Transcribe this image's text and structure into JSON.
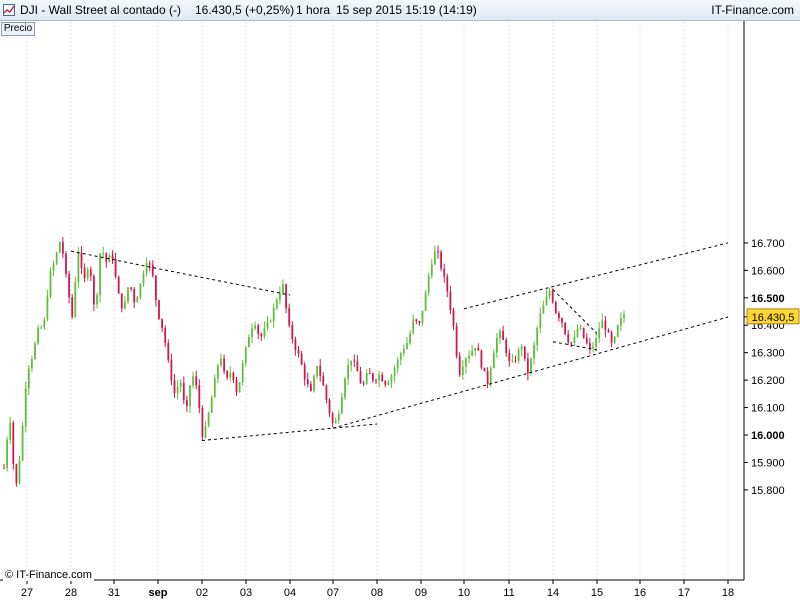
{
  "header": {
    "symbol": "DJI - Wall Street al contado (-)",
    "price_change": "16.430,5 (+0,25%)",
    "interval": "1 hora",
    "datetime": "15 sep 2015 15:19 (14:19)",
    "brand": "IT-Finance.com"
  },
  "panel_label": "Precio",
  "footer": {
    "copyright": "© IT-Finance.com"
  },
  "colors": {
    "up": "#5fbf3a",
    "down": "#d0184e",
    "last_price_bg": "#ffd633",
    "grid": "#c9c9c9"
  },
  "chart_data": {
    "type": "candlestick",
    "title": "DJI - Wall Street al contado (-)",
    "interval": "1 hora",
    "last_price": 16430.5,
    "last_price_label": "16.430,5",
    "ylim": [
      15740,
      16750
    ],
    "y_ticks": [
      15800,
      15900,
      16000,
      16100,
      16200,
      16300,
      16400,
      16500,
      16600,
      16700
    ],
    "y_tick_labels": [
      "15.800",
      "15.900",
      "16.000",
      "16.100",
      "16.200",
      "16.300",
      "16.400",
      "16.500",
      "16.600",
      "16.700"
    ],
    "y_bold_ticks": [
      16000,
      16500
    ],
    "x_tick_labels": [
      "27",
      "28",
      "31",
      "sep",
      "02",
      "03",
      "04",
      "07",
      "08",
      "09",
      "10",
      "11",
      "14",
      "15",
      "16",
      "17",
      "18"
    ],
    "grid": "vertical-dotted",
    "ohlc_path": [
      [
        0,
        15880
      ],
      [
        1,
        16080
      ],
      [
        2,
        15790
      ],
      [
        3,
        15960
      ],
      [
        4,
        16230
      ],
      [
        5,
        16290
      ],
      [
        6,
        16380
      ],
      [
        7,
        16400
      ],
      [
        8,
        16580
      ],
      [
        9,
        16640
      ],
      [
        10,
        16720
      ],
      [
        11,
        16560
      ],
      [
        12,
        16430
      ],
      [
        13,
        16680
      ],
      [
        14,
        16550
      ],
      [
        15,
        16640
      ],
      [
        16,
        16430
      ],
      [
        17,
        16690
      ],
      [
        18,
        16630
      ],
      [
        19,
        16660
      ],
      [
        20,
        16520
      ],
      [
        21,
        16450
      ],
      [
        22,
        16560
      ],
      [
        23,
        16480
      ],
      [
        24,
        16550
      ],
      [
        25,
        16640
      ],
      [
        26,
        16600
      ],
      [
        27,
        16450
      ],
      [
        28,
        16380
      ],
      [
        29,
        16250
      ],
      [
        30,
        16150
      ],
      [
        31,
        16200
      ],
      [
        32,
        16070
      ],
      [
        33,
        16230
      ],
      [
        34,
        16160
      ],
      [
        35,
        15980
      ],
      [
        36,
        16080
      ],
      [
        37,
        16190
      ],
      [
        38,
        16300
      ],
      [
        39,
        16190
      ],
      [
        40,
        16240
      ],
      [
        41,
        16150
      ],
      [
        42,
        16260
      ],
      [
        43,
        16360
      ],
      [
        44,
        16420
      ],
      [
        45,
        16350
      ],
      [
        46,
        16390
      ],
      [
        47,
        16430
      ],
      [
        48,
        16500
      ],
      [
        49,
        16550
      ],
      [
        50,
        16400
      ],
      [
        51,
        16330
      ],
      [
        52,
        16280
      ],
      [
        53,
        16200
      ],
      [
        54,
        16150
      ],
      [
        55,
        16260
      ],
      [
        56,
        16190
      ],
      [
        57,
        16100
      ],
      [
        58,
        16025
      ],
      [
        59,
        16100
      ],
      [
        60,
        16220
      ],
      [
        61,
        16280
      ],
      [
        62,
        16240
      ],
      [
        63,
        16170
      ],
      [
        64,
        16230
      ],
      [
        65,
        16200
      ],
      [
        66,
        16220
      ],
      [
        67,
        16190
      ],
      [
        68,
        16210
      ],
      [
        69,
        16260
      ],
      [
        70,
        16310
      ],
      [
        71,
        16340
      ],
      [
        72,
        16420
      ],
      [
        73,
        16400
      ],
      [
        74,
        16500
      ],
      [
        75,
        16620
      ],
      [
        76,
        16680
      ],
      [
        77,
        16600
      ],
      [
        78,
        16520
      ],
      [
        79,
        16400
      ],
      [
        80,
        16220
      ],
      [
        81,
        16280
      ],
      [
        82,
        16300
      ],
      [
        83,
        16330
      ],
      [
        84,
        16250
      ],
      [
        85,
        16190
      ],
      [
        86,
        16300
      ],
      [
        87,
        16380
      ],
      [
        88,
        16330
      ],
      [
        89,
        16250
      ],
      [
        90,
        16280
      ],
      [
        91,
        16330
      ],
      [
        92,
        16220
      ],
      [
        93,
        16300
      ],
      [
        94,
        16420
      ],
      [
        95,
        16480
      ],
      [
        96,
        16530
      ],
      [
        97,
        16450
      ],
      [
        98,
        16420
      ],
      [
        99,
        16350
      ],
      [
        100,
        16330
      ],
      [
        101,
        16400
      ],
      [
        102,
        16350
      ],
      [
        103,
        16310
      ],
      [
        104,
        16340
      ],
      [
        105,
        16420
      ],
      [
        106,
        16380
      ],
      [
        107,
        16320
      ],
      [
        108,
        16400
      ],
      [
        109,
        16440
      ]
    ],
    "trendlines": [
      {
        "x1": "28",
        "y1": 16670,
        "x2": "04",
        "y2": 16510
      },
      {
        "x1": "02",
        "y1": 15980,
        "x2": "08",
        "y2": 16040
      },
      {
        "x1": "07",
        "y1": 16025,
        "x2": "18",
        "y2": 16430
      },
      {
        "x1": "10",
        "y1": 16460,
        "x2": "18",
        "y2": 16700
      },
      {
        "x1": "14",
        "y1": 16530,
        "x2": "15",
        "y2": 16370
      },
      {
        "x1": "14",
        "y1": 16340,
        "x2": "15",
        "y2": 16310
      }
    ]
  }
}
